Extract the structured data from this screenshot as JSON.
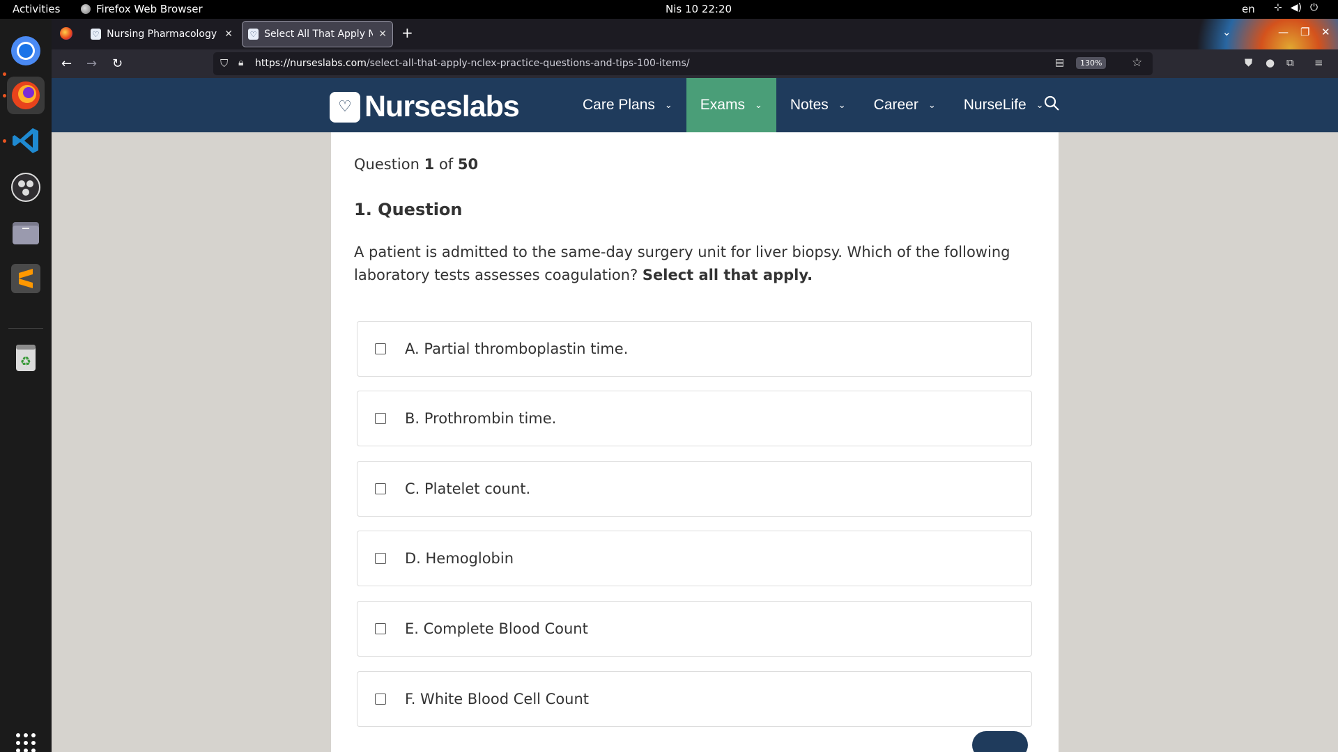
{
  "os_topbar": {
    "activities": "Activities",
    "app_name": "Firefox Web Browser",
    "datetime": "Nis 10  22:20",
    "language": "en"
  },
  "browser": {
    "tabs": [
      {
        "title": "Nursing Pharmacology Q",
        "active": false
      },
      {
        "title": "Select All That Apply NCL",
        "active": true
      }
    ],
    "url_host": "https://nurseslabs.com",
    "url_path": "/select-all-that-apply-nclex-practice-questions-and-tips-100-items/",
    "zoom": "130%"
  },
  "site": {
    "logo_text": "Nurseslabs",
    "nav": [
      {
        "label": "Care Plans",
        "active": false
      },
      {
        "label": "Exams",
        "active": true
      },
      {
        "label": "Notes",
        "active": false
      },
      {
        "label": "Career",
        "active": false
      },
      {
        "label": "NurseLife",
        "active": false
      }
    ]
  },
  "quiz": {
    "counter_prefix": "Question",
    "current": "1",
    "counter_of": "of",
    "total": "50",
    "heading": "1. Question",
    "text": "A patient is admitted to the same-day surgery unit for liver biopsy. Which of the following laboratory tests assesses coagulation?",
    "text_emphasis": "Select all that apply.",
    "options": [
      {
        "label": "A. Partial thromboplastin time.",
        "checked": false
      },
      {
        "label": "B. Prothrombin time.",
        "checked": false
      },
      {
        "label": "C. Platelet count.",
        "checked": false
      },
      {
        "label": "D. Hemoglobin",
        "checked": false
      },
      {
        "label": "E. Complete Blood Count",
        "checked": false
      },
      {
        "label": "F. White Blood Cell Count",
        "checked": false
      }
    ]
  },
  "colors": {
    "header_bg": "#1f3b5c",
    "active_nav_bg": "#4a9e78"
  }
}
